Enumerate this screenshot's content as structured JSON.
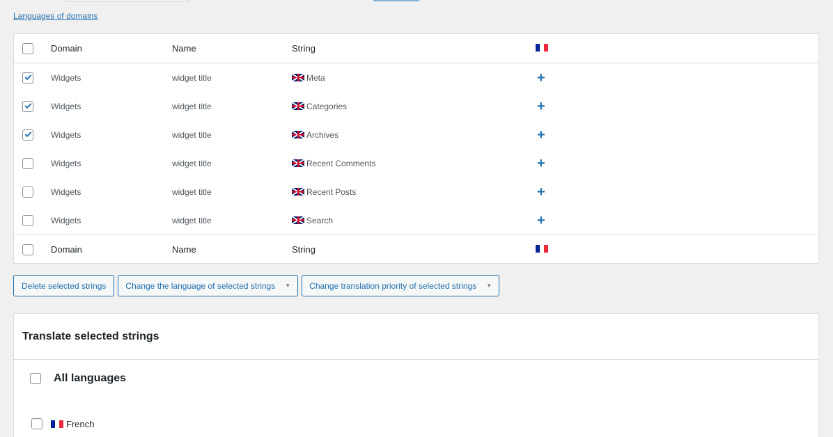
{
  "header": {
    "languages_link": "Languages of domains"
  },
  "table": {
    "columns": {
      "domain": "Domain",
      "name": "Name",
      "string": "String"
    },
    "rows": [
      {
        "domain": "Widgets",
        "name": "widget title",
        "string": "Meta",
        "checked": true
      },
      {
        "domain": "Widgets",
        "name": "widget title",
        "string": "Categories",
        "checked": true
      },
      {
        "domain": "Widgets",
        "name": "widget title",
        "string": "Archives",
        "checked": true
      },
      {
        "domain": "Widgets",
        "name": "widget title",
        "string": "Recent Comments",
        "checked": false
      },
      {
        "domain": "Widgets",
        "name": "widget title",
        "string": "Recent Posts",
        "checked": false
      },
      {
        "domain": "Widgets",
        "name": "widget title",
        "string": "Search",
        "checked": false
      }
    ],
    "add_translation_symbol": "+"
  },
  "bulk_actions": {
    "delete_label": "Delete selected strings",
    "change_language_label": "Change the language of selected strings",
    "change_priority_label": "Change translation priority of selected strings"
  },
  "translate_panel": {
    "title": "Translate selected strings",
    "all_languages_label": "All languages",
    "all_languages_checked": true,
    "languages": [
      {
        "label": "French",
        "checked": true
      }
    ]
  },
  "colors": {
    "accent": "#2271b1",
    "flag_fr_blue": "#002395",
    "flag_fr_white": "#ffffff",
    "flag_fr_red": "#ed2939"
  },
  "icons": {
    "row_add": "plus-icon",
    "checkbox_checked": "checkmark-icon",
    "dropdown": "chevron-down-icon",
    "source_flag": "uk-flag-icon",
    "target_flag": "france-flag-icon"
  }
}
